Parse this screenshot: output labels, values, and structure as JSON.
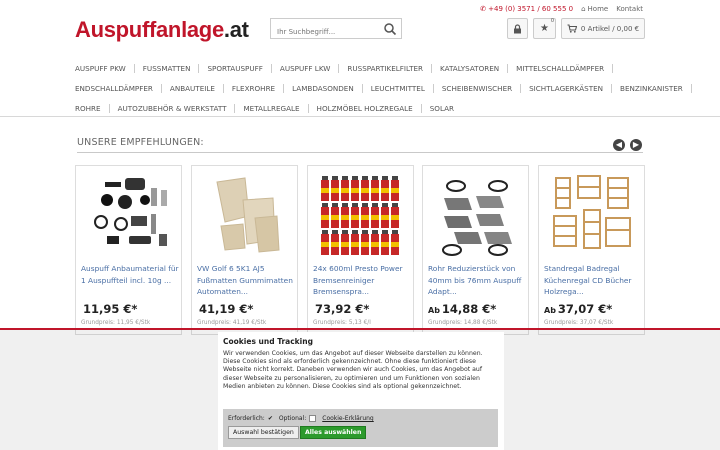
{
  "header": {
    "logo_main": "Auspuffanlage",
    "logo_tld": ".at",
    "phone": "+49 (0) 3571 / 60 555 0",
    "home": "Home",
    "contact": "Kontakt",
    "search_placeholder": "Ihr Suchbegriff...",
    "wishlist_count": "0",
    "cart_label": "0 Artikel / 0,00 €"
  },
  "nav": {
    "row1": [
      "AUSPUFF PKW",
      "FUSSMATTEN",
      "SPORTAUSPUFF",
      "AUSPUFF LKW",
      "RUSSPARTIKELFILTER",
      "KATALYSATOREN",
      "MITTELSCHALLDÄMPFER"
    ],
    "row2": [
      "ENDSCHALLDÄMPFER",
      "ANBAUTEILE",
      "FLEXROHRE",
      "LAMBDASONDEN",
      "LEUCHTMITTEL",
      "SCHEIBENWISCHER",
      "SICHTLAGERKÄSTEN",
      "BENZINKANISTER"
    ],
    "row3": [
      "ROHRE",
      "AUTOZUBEHÖR & WERKSTATT",
      "METALLREGALE",
      "HOLZMÖBEL HOLZREGALE",
      "SOLAR"
    ]
  },
  "recommendations": {
    "title": "UNSERE EMPFEHLUNGEN:",
    "products": [
      {
        "title": "Auspuff Anbaumaterial für 1 Auspuffteil incl. 10g ...",
        "price_prefix": "",
        "price": "11,95 €*",
        "unit": "Grundpreis: 11,95 €/Stk"
      },
      {
        "title": "VW Golf 6 5K1 AJ5 Fußmatten Gummimatten Automatten...",
        "price_prefix": "",
        "price": "41,19 €*",
        "unit": "Grundpreis: 41,19 €/Stk"
      },
      {
        "title": "24x 600ml Presto Power Bremsenreiniger Bremsenspra...",
        "price_prefix": "",
        "price": "73,92 €*",
        "unit": "Grundpreis: 5,13 €/l"
      },
      {
        "title": "Rohr Reduzierstück von 40mm bis 76mm Auspuff Adapt...",
        "price_prefix": "Ab",
        "price": "14,88 €*",
        "unit": "Grundpreis: 14,88 €/Stk"
      },
      {
        "title": "Standregal Badregal Küchenregal CD Bücher Holzrega...",
        "price_prefix": "Ab",
        "price": "37,07 €*",
        "unit": "Grundpreis: 37,07 €/Stk"
      }
    ]
  },
  "cookie": {
    "title": "Cookies und Tracking",
    "text": "Wir verwenden Cookies, um das Angebot auf dieser Webseite darstellen zu können. Diese Cookies sind als erforderlich gekennzeichnet. Ohne diese funktioniert diese Webseite nicht korrekt. Daneben verwenden wir auch Cookies, um das Angebot auf dieser Webseite zu personalisieren, zu optimieren und um Funktionen von sozialen Medien anbieten zu können. Diese Cookies sind als optional gekennzeichnet.",
    "required_label": "Erforderlich:",
    "optional_label": "Optional:",
    "explanation_link": "Cookie-Erklärung",
    "confirm_button": "Auswahl bestätigen",
    "accept_all_button": "Alles auswählen"
  }
}
